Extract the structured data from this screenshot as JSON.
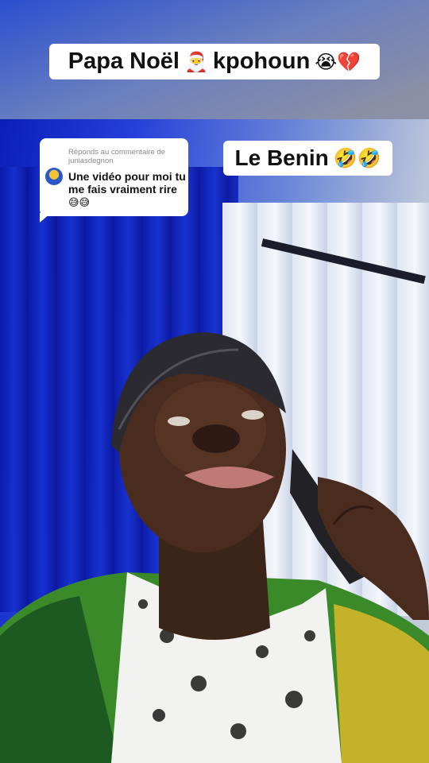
{
  "captions": {
    "top_text": "Papa Noël",
    "top_emoji_1": "🎅",
    "top_text_2": "kpohoun",
    "top_emoji_2": "😭💔",
    "benin_text": "Le Benin",
    "benin_emoji": "🤣🤣"
  },
  "reply": {
    "header": "Réponds au commentaire de",
    "username": "juniasdegnon",
    "comment": "Une vidéo pour moi tu me fais vraiment rire",
    "comment_emoji": "😅😅"
  },
  "colors": {
    "caption_bg": "#ffffff",
    "caption_text": "#111111"
  }
}
